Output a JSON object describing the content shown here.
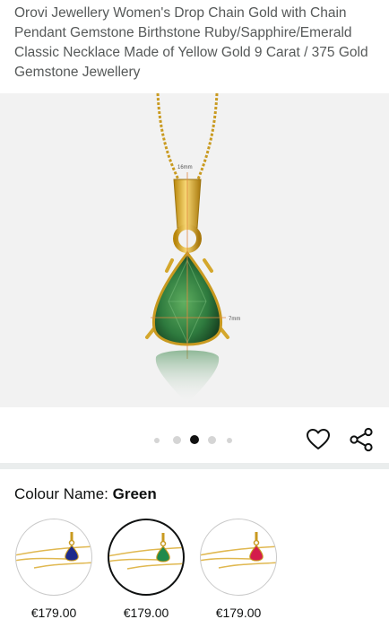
{
  "product": {
    "title": "Orovi Jewellery Women's Drop Chain Gold with Chain Pendant Gemstone Birthstone Ruby/Sapphire/Emerald Classic Necklace Made of Yellow Gold 9 Carat / 375 Gold Gemstone Jewellery"
  },
  "image": {
    "dimension_height": "16mm",
    "dimension_width": "7mm",
    "gem_color": "#2e7a3e"
  },
  "carousel": {
    "total": 5,
    "active_index": 2
  },
  "icons": {
    "wishlist": "heart-icon",
    "share": "share-icon"
  },
  "colour": {
    "label": "Colour Name:",
    "selected": "Green"
  },
  "variants": [
    {
      "gem": "sapphire",
      "color": "#1c2a8c",
      "price": "€179.00",
      "selected": false
    },
    {
      "gem": "emerald",
      "color": "#1f8a4c",
      "price": "€179.00",
      "selected": true
    },
    {
      "gem": "ruby",
      "color": "#d41c4c",
      "price": "€179.00",
      "selected": false
    }
  ]
}
